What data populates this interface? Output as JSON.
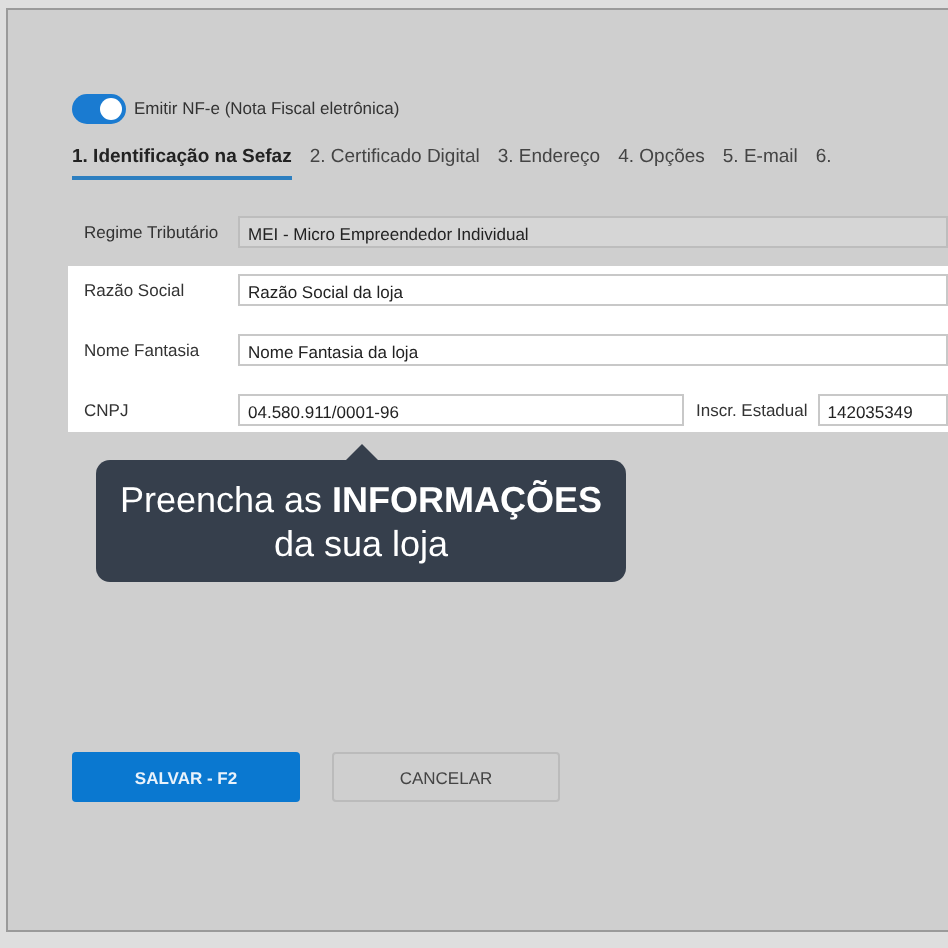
{
  "toggle": {
    "label": "Emitir NF-e (Nota Fiscal eletrônica)",
    "on": true
  },
  "tabs": [
    {
      "label": "1. Identificação na Sefaz",
      "selected": true
    },
    {
      "label": "2. Certificado Digital",
      "selected": false
    },
    {
      "label": "3. Endereço",
      "selected": false
    },
    {
      "label": "4. Opções",
      "selected": false
    },
    {
      "label": "5. E-mail",
      "selected": false
    },
    {
      "label": "6.",
      "selected": false
    }
  ],
  "regime": {
    "label": "Regime Tributário",
    "value": "MEI - Micro Empreendedor Individual"
  },
  "highlighted_fields": [
    {
      "label": "Razão Social",
      "value": "Razão Social da loja"
    },
    {
      "label": "Nome Fantasia",
      "value": "Nome Fantasia da loja"
    }
  ],
  "cnpj": {
    "label": "CNPJ",
    "value": "04.580.911/0001-96"
  },
  "inscricao": {
    "label": "Inscr. Estadual",
    "value": "142035349"
  },
  "tooltip": {
    "lines": [
      "Preencha as **INFORMAÇÕES**",
      "da sua loja"
    ]
  },
  "buttons": [
    {
      "label": "SALVAR - F2",
      "kind": "primary"
    },
    {
      "label": "CANCELAR",
      "kind": "secondary"
    }
  ]
}
